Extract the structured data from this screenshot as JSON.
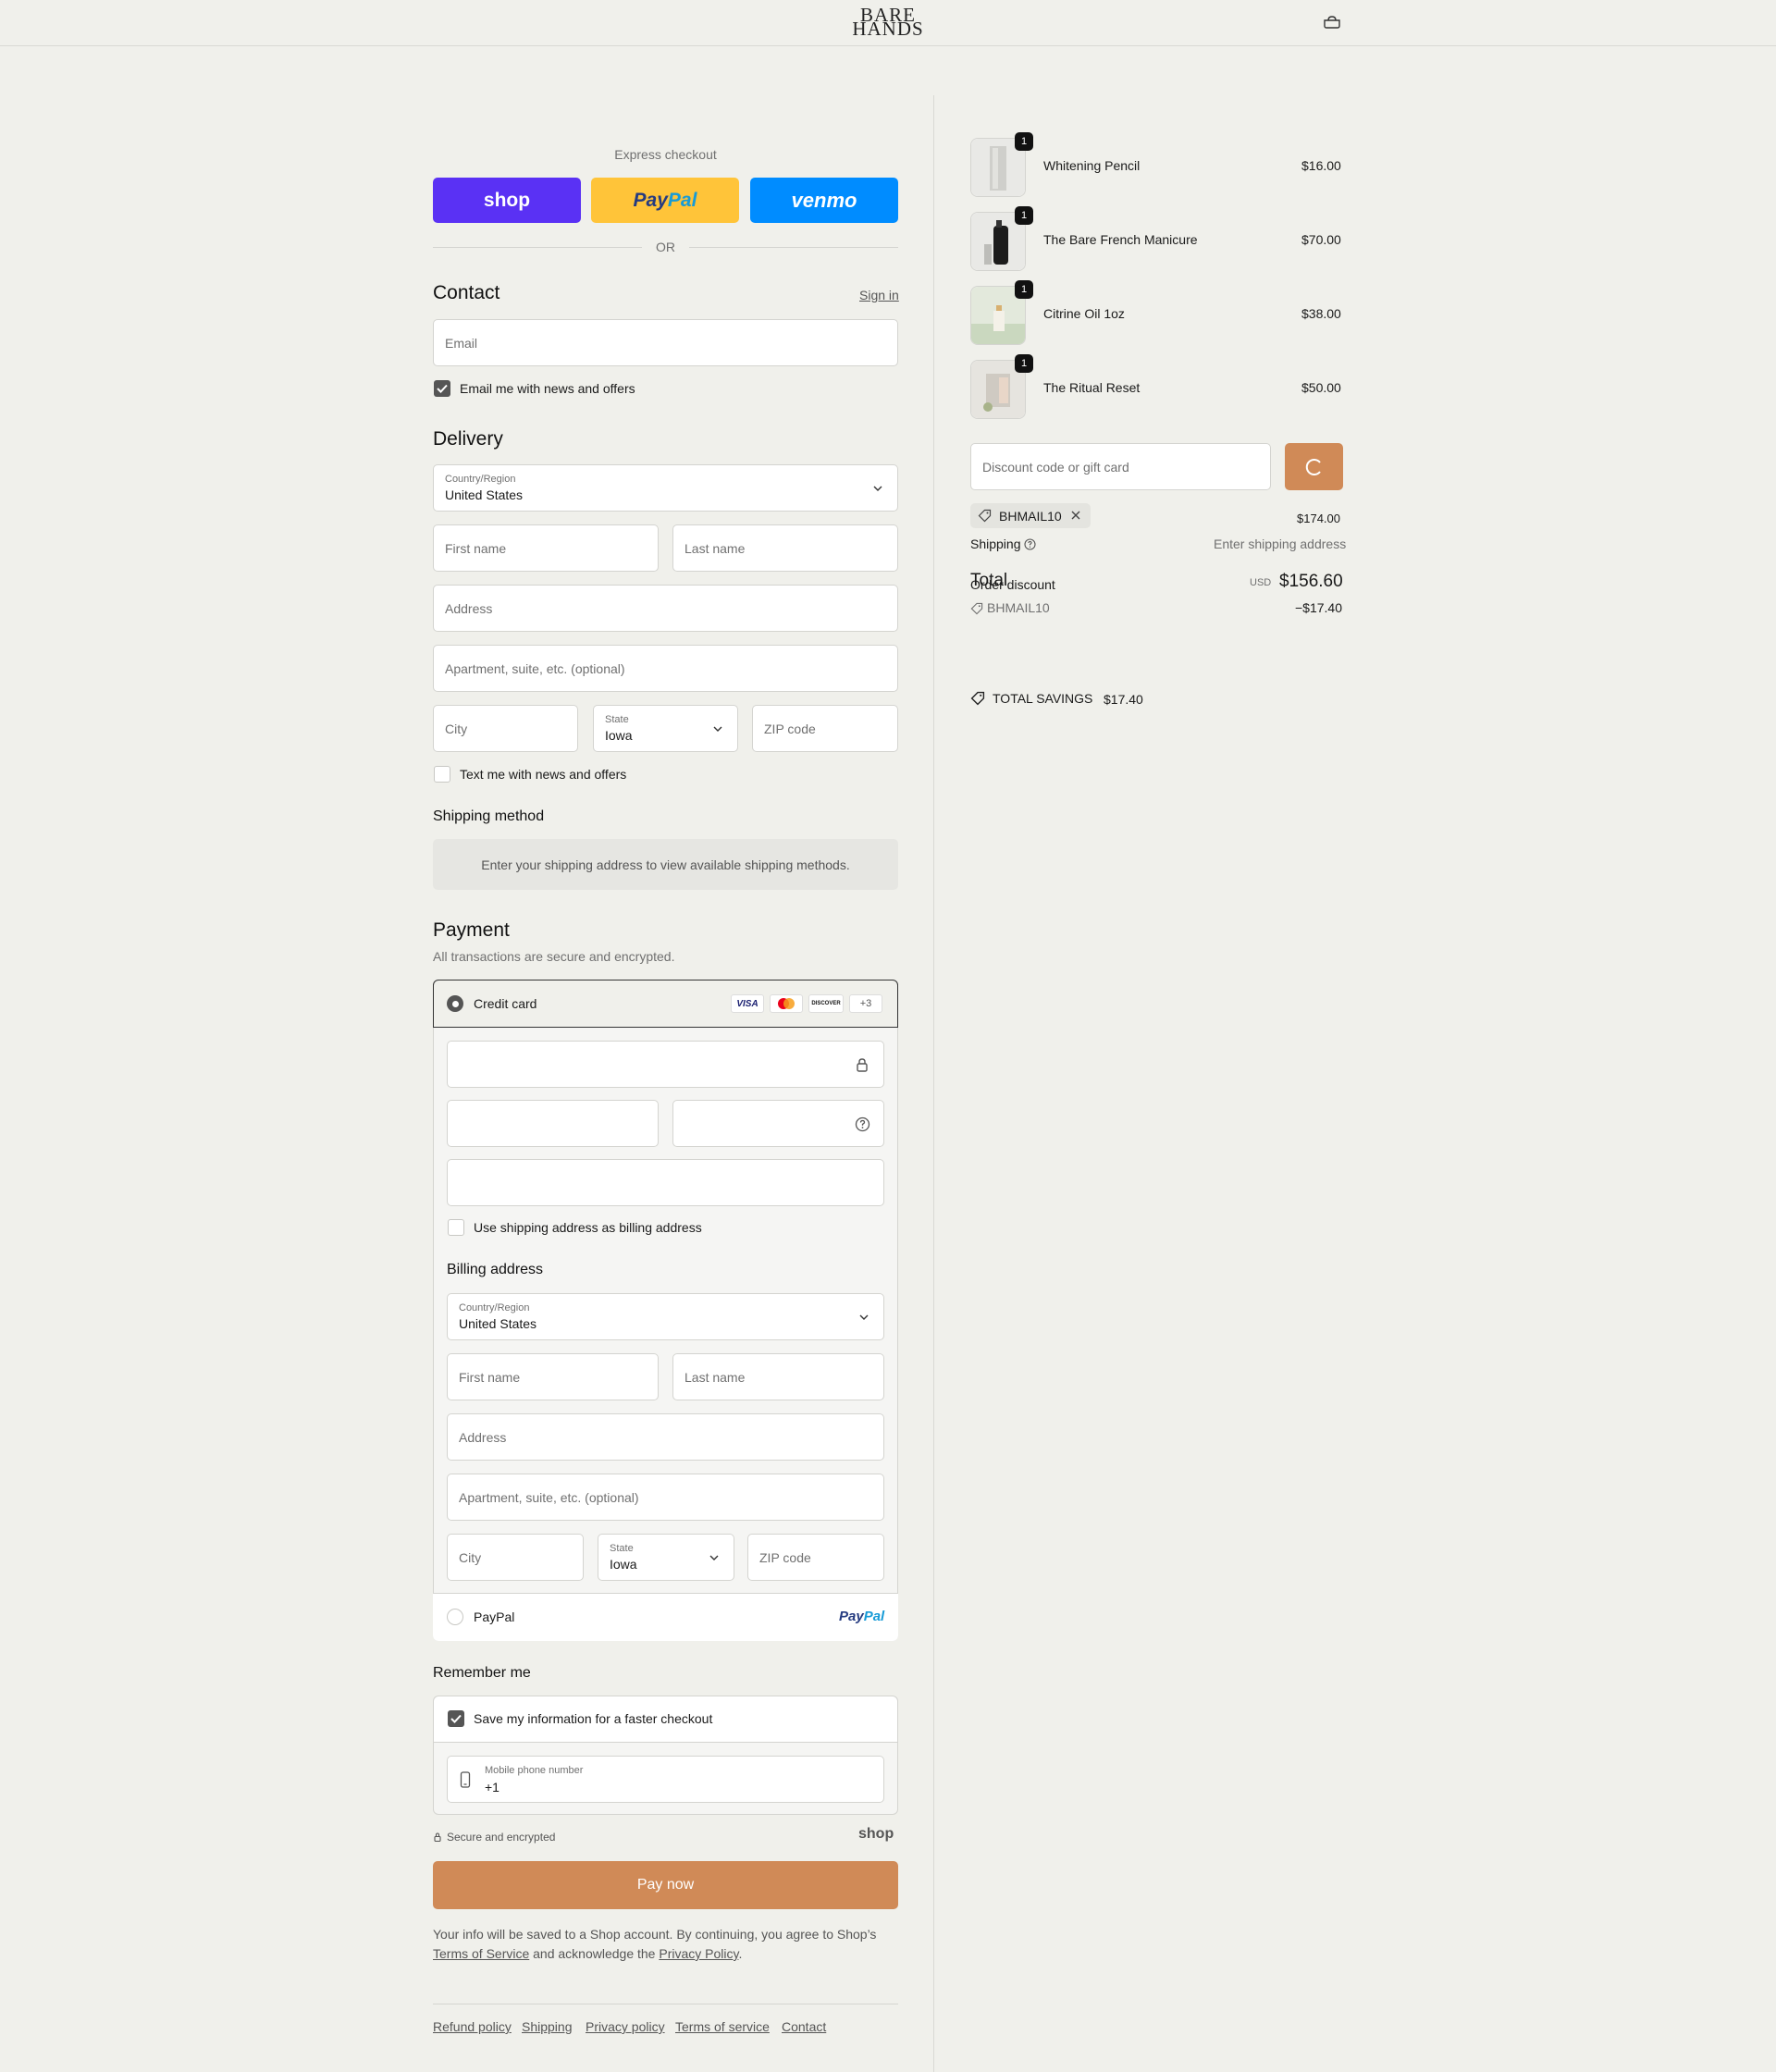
{
  "header": {
    "logo_line1": "BARE",
    "logo_line2": "HANDS",
    "cart_icon": "bag-icon"
  },
  "express": {
    "title": "Express checkout",
    "shop_label": "shop",
    "paypal_label_a": "Pay",
    "paypal_label_b": "Pal",
    "venmo_label": "venmo",
    "or_label": "OR"
  },
  "contact": {
    "title": "Contact",
    "sign_in": "Sign in",
    "email_placeholder": "Email",
    "newsletter_label": "Email me with news and offers",
    "newsletter_checked": true
  },
  "delivery": {
    "title": "Delivery",
    "country_label": "Country/Region",
    "country_value": "United States",
    "first_name": "First name",
    "last_name": "Last name",
    "address": "Address",
    "apartment": "Apartment, suite, etc. (optional)",
    "city": "City",
    "state_label": "State",
    "state_value": "Iowa",
    "zip": "ZIP code",
    "sms_label": "Text me with news and offers"
  },
  "shipping_method": {
    "title": "Shipping method",
    "notice": "Enter your shipping address to view available shipping methods."
  },
  "payment": {
    "title": "Payment",
    "subtitle": "All transactions are secure and encrypted.",
    "credit_card_label": "Credit card",
    "card_logos": [
      "VISA",
      "DISCOVER"
    ],
    "more_cards": "+3",
    "use_shipping_label": "Use shipping address as billing address",
    "billing_title": "Billing address",
    "country_label": "Country/Region",
    "country_value": "United States",
    "first_name": "First name",
    "last_name": "Last name",
    "address": "Address",
    "apartment": "Apartment, suite, etc. (optional)",
    "city": "City",
    "state_label": "State",
    "state_value": "Iowa",
    "zip": "ZIP code",
    "paypal_label": "PayPal",
    "paypal_logo_a": "Pay",
    "paypal_logo_b": "Pal"
  },
  "remember": {
    "title": "Remember me",
    "save_label": "Save my information for a faster checkout",
    "phone_label": "Mobile phone number",
    "phone_value": "+1",
    "secure_label": "Secure and encrypted",
    "shop_logo": "shop"
  },
  "pay_now": "Pay now",
  "legal": {
    "line1": "Your info will be saved to a Shop account. By continuing, you agree to Shop’s",
    "terms": "Terms of Service",
    "middle": "and acknowledge the",
    "privacy": "Privacy Policy",
    "end": "."
  },
  "footer_links": [
    "Refund policy",
    "Shipping",
    "Privacy policy",
    "Terms of service",
    "Contact"
  ],
  "summary": {
    "items": [
      {
        "name": "Whitening Pencil",
        "price": "$16.00",
        "qty": "1"
      },
      {
        "name": "The Bare French Manicure",
        "price": "$70.00",
        "qty": "1"
      },
      {
        "name": "Citrine Oil 1oz",
        "price": "$38.00",
        "qty": "1"
      },
      {
        "name": "The Ritual Reset",
        "price": "$50.00",
        "qty": "1"
      }
    ],
    "discount_placeholder": "Discount code or gift card",
    "applied_code": "BHMAIL10",
    "subtotal": "$174.00",
    "shipping_label": "Shipping",
    "shipping_value": "Enter shipping address",
    "total_label": "Total",
    "order_discount_label": "Order discount",
    "currency": "USD",
    "total_value": "$156.60",
    "discount_code": "BHMAIL10",
    "discount_value": "−$17.40",
    "savings_label": "TOTAL SAVINGS",
    "savings_value": "$17.40"
  },
  "colors": {
    "accent": "#d08a57",
    "shop": "#5a31f4",
    "paypal": "#ffc439",
    "venmo": "#008cff",
    "bg": "#f0f0eb"
  }
}
